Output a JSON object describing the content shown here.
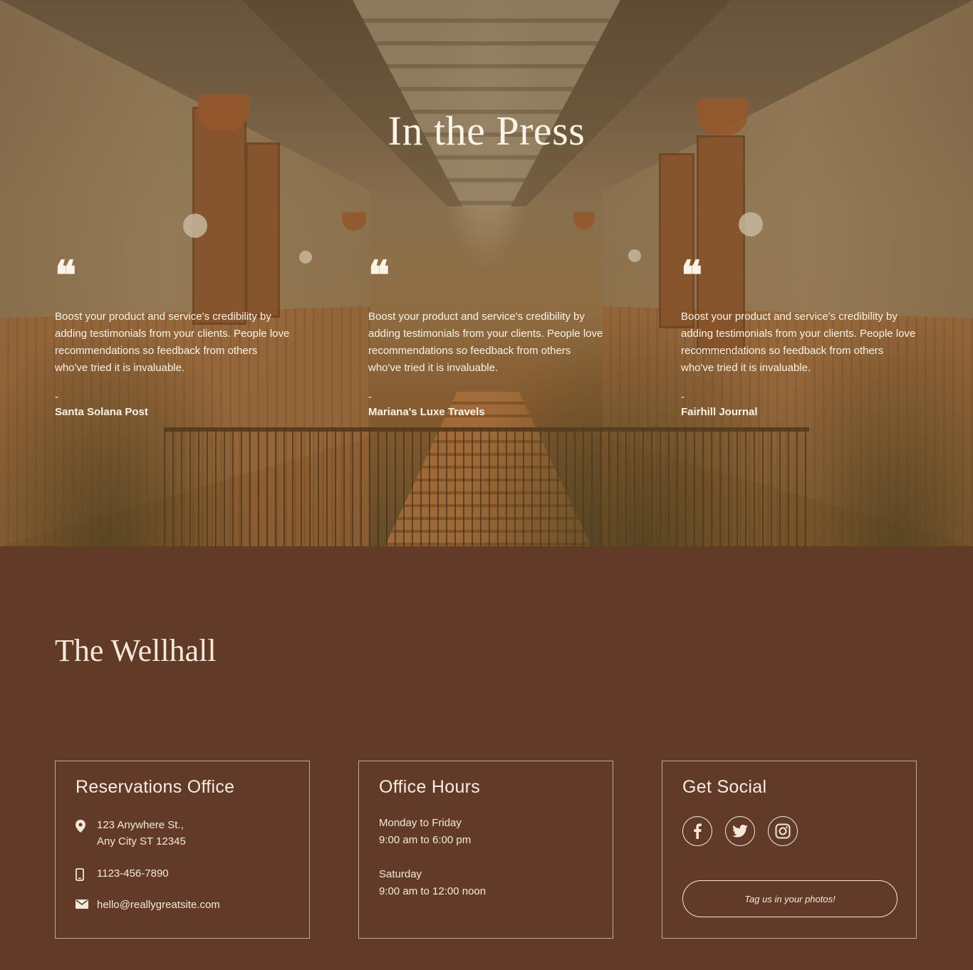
{
  "press": {
    "title": "In the Press",
    "testimonials": [
      {
        "quote_icon": "quote-icon",
        "text": "Boost your product and service's credibility by adding testimonials from your clients. People love recommendations so feedback from others who've tried it is invaluable.",
        "dash": "-",
        "source": "Santa Solana Post"
      },
      {
        "quote_icon": "quote-icon",
        "text": "Boost your product and service's credibility by adding testimonials from your clients. People love recommendations so feedback from others who've tried it is invaluable.",
        "dash": "-",
        "source": "Mariana's Luxe Travels"
      },
      {
        "quote_icon": "quote-icon",
        "text": "Boost your product and service's credibility by adding testimonials from your clients. People love recommendations so feedback from others who've tried it is invaluable.",
        "dash": "-",
        "source": "Fairhill Journal"
      }
    ]
  },
  "footer": {
    "brand": "The Wellhall",
    "reservations": {
      "title": "Reservations Office",
      "address_line1": "123 Anywhere St.,",
      "address_line2": "Any City ST 12345",
      "phone": "1123-456-7890",
      "email": "hello@reallygreatsite.com"
    },
    "hours": {
      "title": "Office Hours",
      "weekday_label": "Monday to Friday",
      "weekday_time": "9:00 am to 6:00 pm",
      "saturday_label": "Saturday",
      "saturday_time": "9:00 am to 12:00 noon"
    },
    "social": {
      "title": "Get Social",
      "icons": [
        "facebook-icon",
        "twitter-icon",
        "instagram-icon"
      ],
      "tag_button": "Tag us in your photos!"
    }
  },
  "colors": {
    "footer_bg": "#623b28",
    "text_light": "#f4e8da",
    "card_border": "#c7a88f"
  }
}
